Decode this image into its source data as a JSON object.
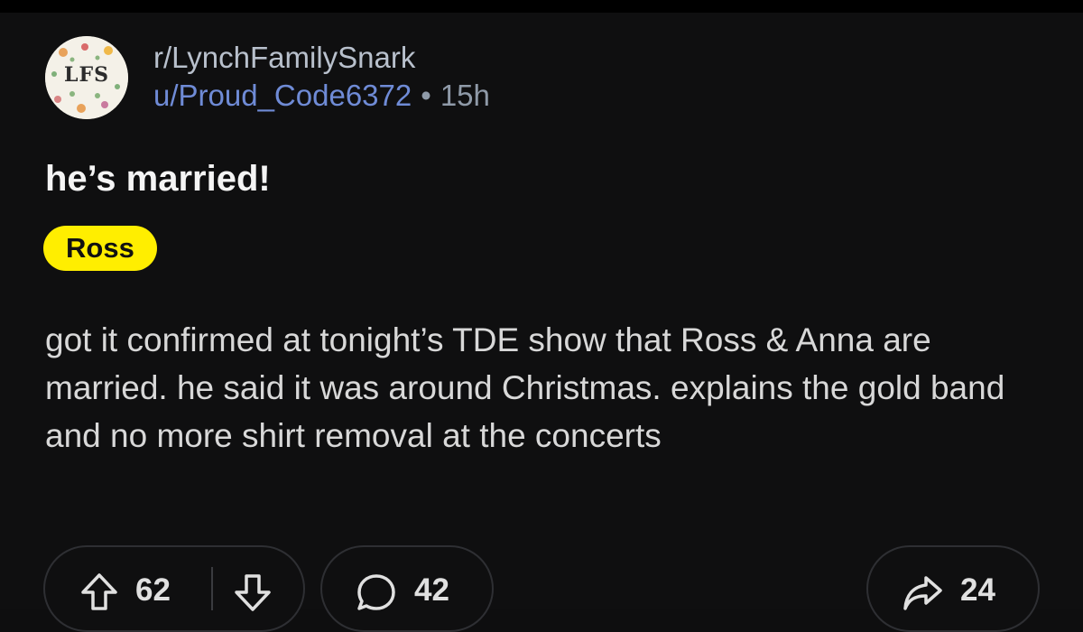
{
  "post": {
    "subreddit": "r/LynchFamilySnark",
    "username": "u/Proud_Code6372",
    "separator": "•",
    "age": "15h",
    "avatar_text": "LFS",
    "title": "he’s married!",
    "flair": "Ross",
    "body": "got it confirmed at tonight’s TDE show that Ross & Anna are married. he said it was around Christmas. explains the gold band and no more shirt removal at the concerts"
  },
  "actions": {
    "upvotes": "62",
    "comments": "42",
    "shares": "24"
  },
  "icons": {
    "upvote": "arrow-up-icon",
    "downvote": "arrow-down-icon",
    "comment": "speech-bubble-icon",
    "share": "share-arrow-icon"
  },
  "colors": {
    "background": "#0f0f10",
    "flair_bg": "#ffee00",
    "username": "#6f8bd6"
  }
}
